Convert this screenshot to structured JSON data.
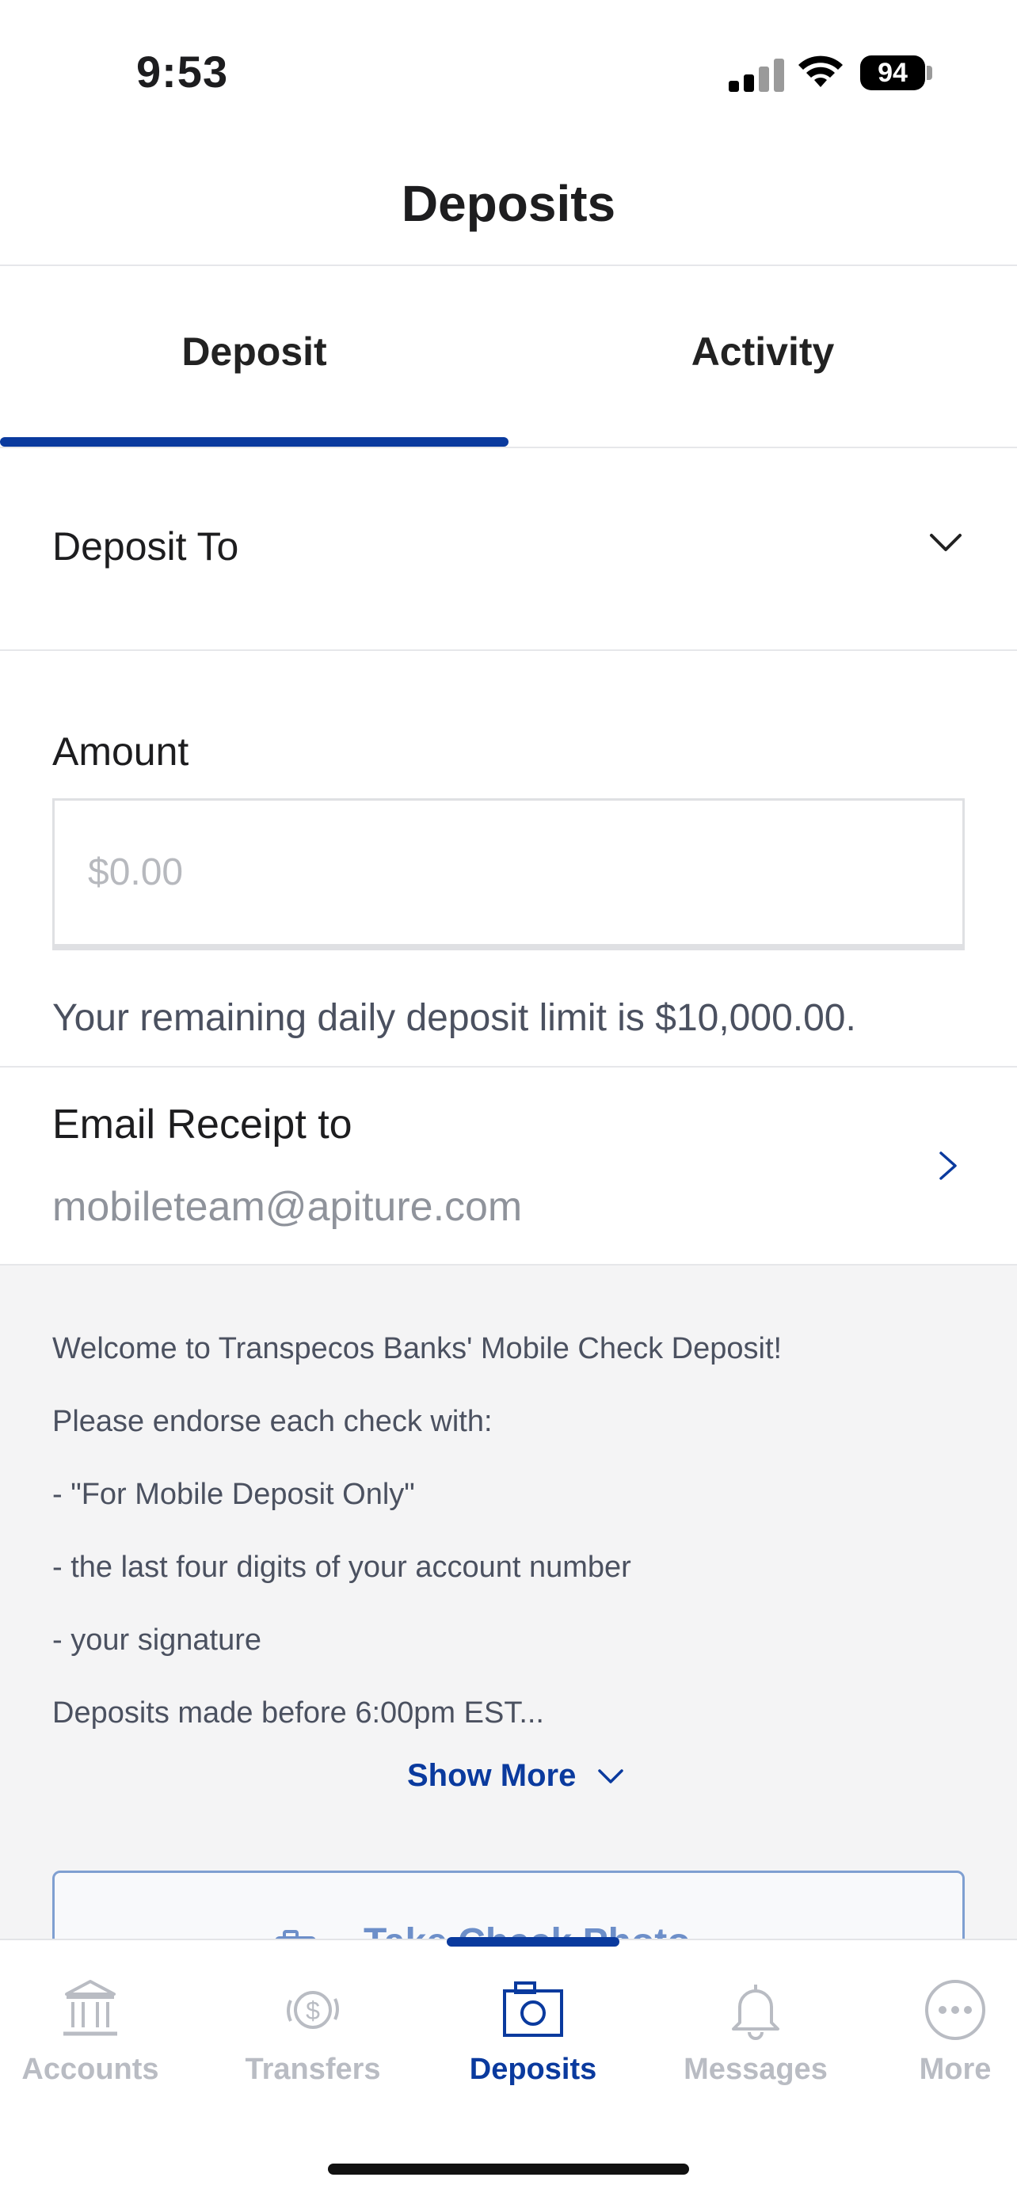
{
  "status_bar": {
    "time": "9:53",
    "battery": "94"
  },
  "header": {
    "title": "Deposits"
  },
  "tabs": [
    {
      "label": "Deposit",
      "active": true
    },
    {
      "label": "Activity",
      "active": false
    }
  ],
  "deposit_to": {
    "label": "Deposit To"
  },
  "amount": {
    "label": "Amount",
    "placeholder": "$0.00",
    "value": ""
  },
  "limit_text": "Your remaining daily deposit limit is $10,000.00.",
  "email_receipt": {
    "label": "Email Receipt to",
    "value": "mobileteam@apiture.com"
  },
  "info": {
    "lines": [
      "Welcome to Transpecos Banks' Mobile Check Deposit!",
      "Please endorse each check with:",
      "- \"For Mobile Deposit Only\"",
      "- the last four digits of your account number",
      "- your signature",
      "Deposits made before 6:00pm EST..."
    ],
    "show_more": "Show More"
  },
  "take_photo": {
    "label": "Take Check Photo"
  },
  "bottom_nav": [
    {
      "label": "Accounts",
      "icon": "bank-icon",
      "active": false
    },
    {
      "label": "Transfers",
      "icon": "transfer-dollar-icon",
      "active": false
    },
    {
      "label": "Deposits",
      "icon": "camera-icon",
      "active": true
    },
    {
      "label": "Messages",
      "icon": "bell-icon",
      "active": false
    },
    {
      "label": "More",
      "icon": "more-dots-icon",
      "active": false
    }
  ],
  "colors": {
    "accent": "#0a3a9e",
    "inactive": "#b9bcc3",
    "panel_bg": "#f4f4f5"
  }
}
